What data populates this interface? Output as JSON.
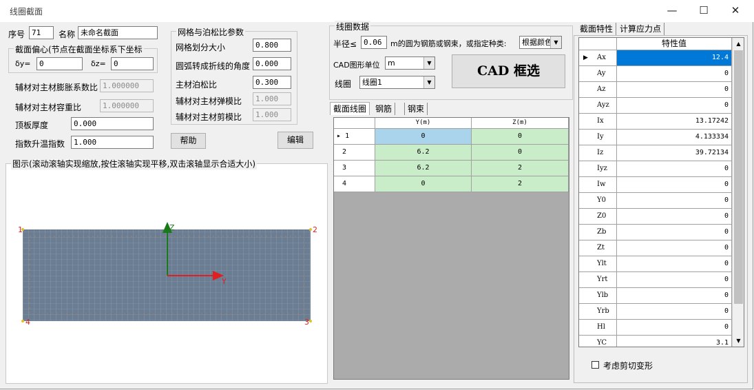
{
  "window": {
    "title": "线圈截面",
    "minimize": "—",
    "maximize": "☐",
    "close": "✕"
  },
  "basic": {
    "seq_label": "序号",
    "seq_value": "71",
    "name_label": "名称",
    "name_value": "未命名截面"
  },
  "eccentricity": {
    "legend": "截面偏心(节点在截面坐标系下坐标",
    "dy_label": "δy=",
    "dy_value": "0",
    "dz_label": "δz=",
    "dz_value": "0"
  },
  "material": {
    "expansion_label": "辅材对主材膨胀系数比",
    "expansion_value": "1.000000",
    "density_label": "辅材对主材容重比",
    "density_value": "1.000000",
    "topplate_label": "顶板厚度",
    "topplate_value": "0.000",
    "temp_label": "指数升温指数",
    "temp_value": "1.000"
  },
  "mesh": {
    "legend": "网格与泊松比参数",
    "size_label": "网格划分大小",
    "size_value": "0.800",
    "arc_label": "圆弧转成折线的角度",
    "arc_value": "0.000",
    "poisson_label": "主材泊松比",
    "poisson_value": "0.300",
    "elastic_label": "辅材对主材弹模比",
    "elastic_value": "1.000",
    "shear_label": "辅材对主材剪模比",
    "shear_value": "1.000"
  },
  "buttons": {
    "help": "帮助",
    "edit": "编辑",
    "cad_select": "CAD 框选"
  },
  "preview": {
    "legend": "图示(滚动滚轴实现缩放,按住滚轴实现平移,双击滚轴显示合适大小)",
    "corner_labels": [
      "1",
      "2",
      "3",
      "4"
    ],
    "axis_z": "Z",
    "axis_y": "Y",
    "fill_color": "#6b7d93",
    "axis_z_color": "#1a7a1a",
    "axis_y_color": "#e02020",
    "corner_color": "#e02020"
  },
  "coil": {
    "legend": "线圈数据",
    "radius_prefix": "半径≤",
    "radius_value": "0.06",
    "radius_suffix": "m的圆为钢筋或钢束，或指定种类:",
    "kind_value": "根据颜色",
    "unit_label": "CAD图形单位",
    "unit_value": "m",
    "coil_label": "线圈",
    "coil_value": "线圈1"
  },
  "section_tabs": [
    "截面线圈",
    "钢筋",
    "钢束"
  ],
  "coords": {
    "headers": [
      "Y(m)",
      "Z(m)"
    ],
    "rows": [
      {
        "id": "1",
        "y": "0",
        "z": "0"
      },
      {
        "id": "2",
        "y": "6.2",
        "z": "0"
      },
      {
        "id": "3",
        "y": "6.2",
        "z": "2"
      },
      {
        "id": "4",
        "y": "0",
        "z": "2"
      }
    ]
  },
  "prop_tabs": [
    "截面特性",
    "计算应力点"
  ],
  "props": {
    "header": "特性值",
    "rows": [
      {
        "name": "Ax",
        "value": "12.4"
      },
      {
        "name": "Ay",
        "value": "0"
      },
      {
        "name": "Az",
        "value": "0"
      },
      {
        "name": "Ayz",
        "value": "0"
      },
      {
        "name": "Ix",
        "value": "13.17242"
      },
      {
        "name": "Iy",
        "value": "4.133334"
      },
      {
        "name": "Iz",
        "value": "39.72134"
      },
      {
        "name": "Iyz",
        "value": "0"
      },
      {
        "name": "Iw",
        "value": "0"
      },
      {
        "name": "Y0",
        "value": "0"
      },
      {
        "name": "Z0",
        "value": "0"
      },
      {
        "name": "Zb",
        "value": "0"
      },
      {
        "name": "Zt",
        "value": "0"
      },
      {
        "name": "Ylt",
        "value": "0"
      },
      {
        "name": "Yrt",
        "value": "0"
      },
      {
        "name": "Ylb",
        "value": "0"
      },
      {
        "name": "Yrb",
        "value": "0"
      },
      {
        "name": "Hl",
        "value": "0"
      },
      {
        "name": "YC",
        "value": "3.1"
      }
    ]
  },
  "shear": {
    "label": "考虑剪切变形",
    "checked": false
  }
}
